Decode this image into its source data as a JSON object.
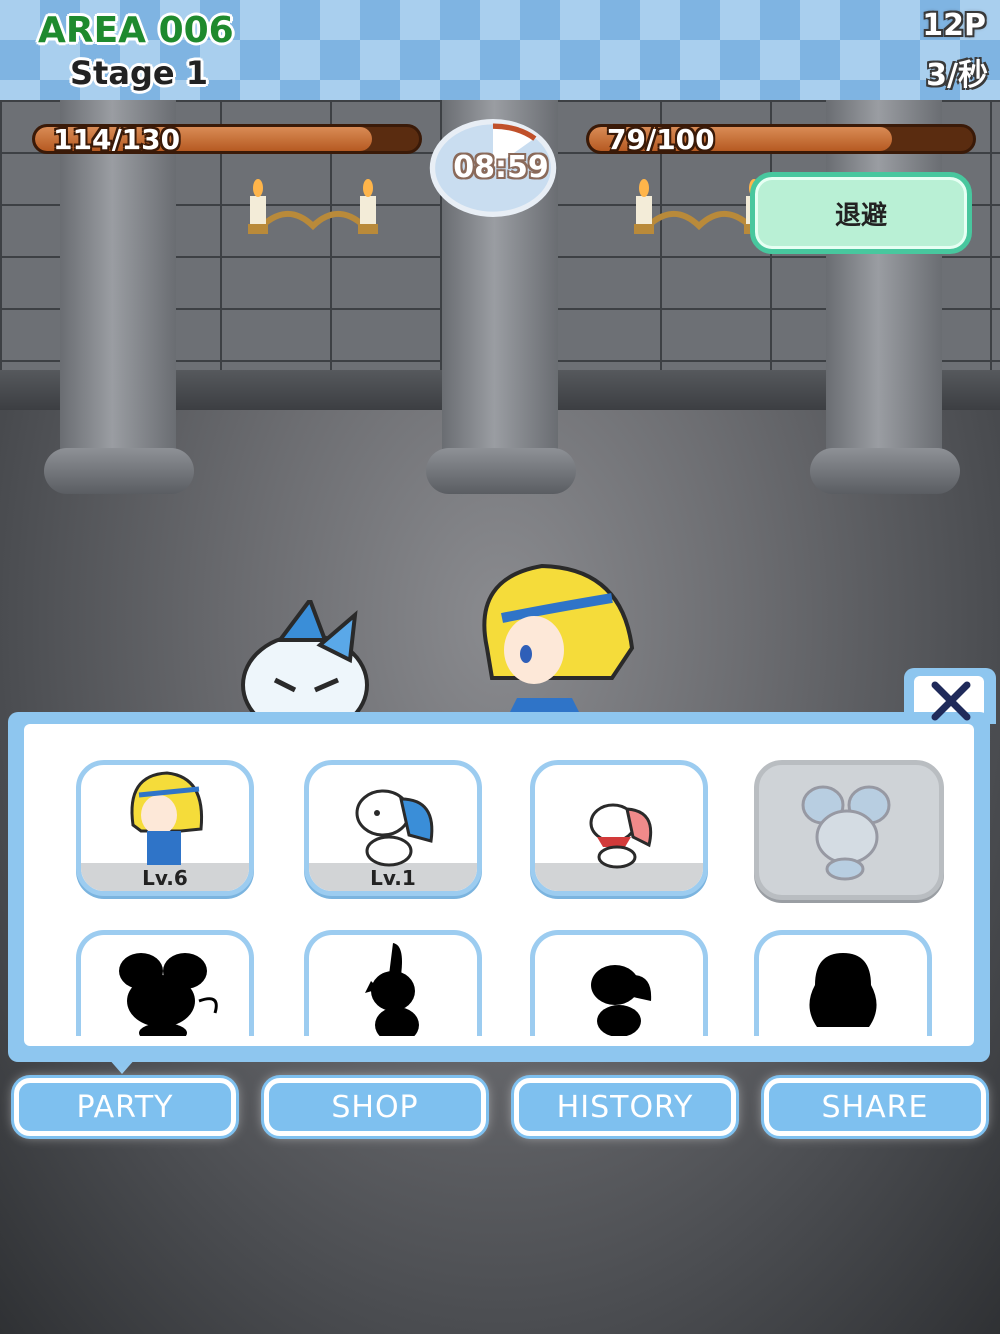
{
  "header": {
    "area": "AREA 006",
    "stage": "Stage 1",
    "points": "12P",
    "rate": "3/秒"
  },
  "battle": {
    "player_hp": {
      "label": "114/130",
      "current": 114,
      "max": 130
    },
    "enemy_hp": {
      "label": "79/100",
      "current": 79,
      "max": 100
    },
    "timer": "08:59",
    "escape_label": "退避"
  },
  "party": {
    "close_icon": "close-icon",
    "slots": [
      {
        "character": "blonde-hero",
        "level": "Lv.6",
        "state": "unlocked"
      },
      {
        "character": "white-blue-creature",
        "level": "Lv.1",
        "state": "unlocked"
      },
      {
        "character": "white-red-creature",
        "level": "",
        "state": "unlocked"
      },
      {
        "character": "mouse-creature",
        "level": "",
        "state": "locked"
      },
      {
        "character": "silhouette-mouse",
        "level": "",
        "state": "hidden"
      },
      {
        "character": "silhouette-rabbit",
        "level": "",
        "state": "hidden"
      },
      {
        "character": "silhouette-beast",
        "level": "",
        "state": "hidden"
      },
      {
        "character": "silhouette-blob",
        "level": "",
        "state": "hidden"
      }
    ]
  },
  "nav": {
    "party": "PARTY",
    "shop": "SHOP",
    "history": "HISTORY",
    "share": "SHARE"
  },
  "colors": {
    "accent": "#7ec0ef",
    "area_text": "#1f8a2e",
    "hp_fill": "#b65a22",
    "escape_bg": "#b9f0d5"
  }
}
